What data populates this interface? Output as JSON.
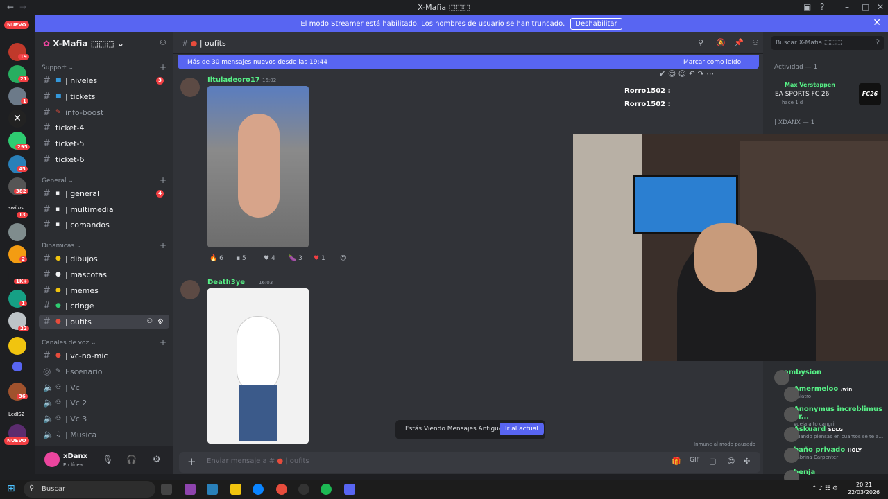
{
  "window": {
    "title": "X-Mafia ⬚⬚⬚"
  },
  "banner": {
    "text": "El modo Streamer está habilitado. Los nombres de usuario se han truncado.",
    "button": "Deshabilitar"
  },
  "rail": {
    "badges": [
      "2",
      "19",
      "21",
      "1",
      "295",
      "45",
      "382",
      "13",
      "2",
      "1K+",
      "1",
      "22",
      "36"
    ],
    "new_label": "NUEVO",
    "items_text": [
      "swims",
      "LcdIS2"
    ]
  },
  "guild": {
    "name": "X-Mafia ⬚⬚⬚"
  },
  "sidebar": {
    "categories": [
      "Support",
      "General",
      "Dinamicas",
      "Canales de voz"
    ],
    "channels": [
      {
        "name": "| niveles",
        "badge": "3"
      },
      {
        "name": "| tickets"
      },
      {
        "name": "info-boost"
      },
      {
        "name": "ticket-4"
      },
      {
        "name": "ticket-5"
      },
      {
        "name": "ticket-6"
      },
      {
        "name": "| general",
        "badge": "4"
      },
      {
        "name": "| multimedia"
      },
      {
        "name": "| comandos"
      },
      {
        "name": "| dibujos"
      },
      {
        "name": "| mascotas"
      },
      {
        "name": "| memes"
      },
      {
        "name": "| cringe"
      },
      {
        "name": "| oufits"
      },
      {
        "name": "| vc-no-mic"
      },
      {
        "name": "Escenario"
      },
      {
        "name": "| Vc"
      },
      {
        "name": "| Vc 2"
      },
      {
        "name": "| Vc 3"
      },
      {
        "name": "| Musica"
      }
    ]
  },
  "user": {
    "name": "xDanx",
    "status": "En línea"
  },
  "chat": {
    "channel": "| oufits",
    "new_messages": "Más de 30 mensajes nuevos desde las 19:44",
    "mark_read": "Marcar como leído",
    "messages": [
      {
        "author": "Iltuladeoro17",
        "time": "16:02"
      },
      {
        "author": "Death3ye",
        "time": "16:03"
      }
    ],
    "reactions": [
      "6",
      "5",
      "4",
      "3",
      "1"
    ],
    "old_notice": "Estás Viendo Mensajes Antiguos",
    "jump_button": "Ir al actual",
    "compose_placeholder": "Enviar mensaje a #",
    "compose_channel": "| oufits",
    "overlay_lines": [
      "Rorro1502 :",
      "Rorro1502 :"
    ],
    "paused_note": "Inmune al modo pausado"
  },
  "members": {
    "search_placeholder": "Buscar X-Mafia ⬚⬚⬚",
    "activity_header": "Actividad — 1",
    "activity": {
      "name": "Max Verstappen",
      "game": "EA SPORTS FC 26",
      "ago": "hace 1 d",
      "logo": "FC26"
    },
    "group2": "| XDANX — 1",
    "list": [
      {
        "name": "ambysion",
        "sub": "",
        "tag": ""
      },
      {
        "name": "Amermeloo",
        "sub": "Balatro",
        "tag": ".win"
      },
      {
        "name": "Anonymus increblimus pr...",
        "sub": "vuela alto cangri",
        "tag": ""
      },
      {
        "name": "Askuard",
        "sub": "Cuando piensas en cuantos se te a...",
        "tag": "SDLG"
      },
      {
        "name": "baño privado",
        "sub": "Sabrina Carpenter",
        "tag": "HOLY"
      },
      {
        "name": "benja",
        "sub": "",
        "tag": ""
      }
    ]
  },
  "taskbar": {
    "search": "Buscar",
    "time": "20:21",
    "date": "22/03/2026"
  }
}
